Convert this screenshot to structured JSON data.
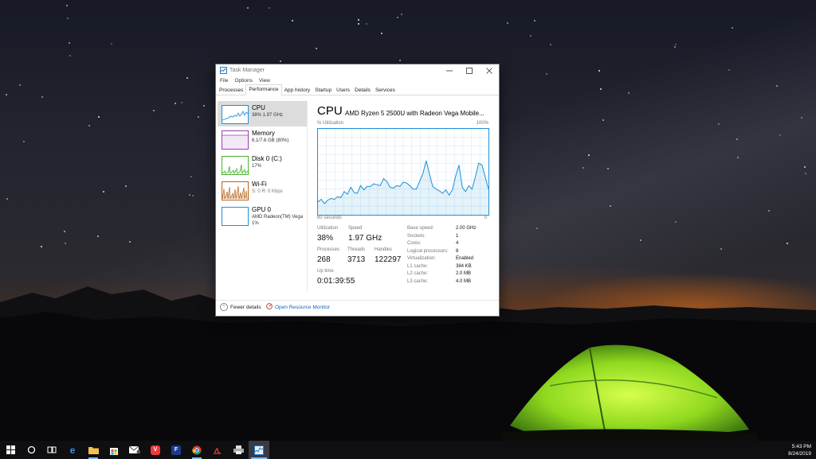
{
  "window": {
    "title": "Task Manager",
    "menu": [
      "File",
      "Options",
      "View"
    ],
    "tabs": [
      "Processes",
      "Performance",
      "App history",
      "Startup",
      "Users",
      "Details",
      "Services"
    ],
    "active_tab": "Performance"
  },
  "resources": [
    {
      "name": "CPU",
      "detail": "38%  1.97 GHz",
      "color": "#1e90d6"
    },
    {
      "name": "Memory",
      "detail": "6.1/7.6 GB (80%)",
      "color": "#9b3fae"
    },
    {
      "name": "Disk 0 (C:)",
      "detail": "17%",
      "color": "#4caf2d"
    },
    {
      "name": "Wi-Fi",
      "detail": "S: 0  R: 0 Kbps",
      "color": "#b8641a"
    },
    {
      "name": "GPU 0",
      "detail": "AMD Radeon(TM) Vega",
      "detail2": "1%",
      "color": "#1e90d6"
    }
  ],
  "cpu": {
    "title": "CPU",
    "model": "AMD Ryzen 5 2500U with Radeon Vega Mobile...",
    "graph_label": "% Utilization",
    "graph_max": "100%",
    "axis_left": "60 seconds",
    "axis_right": "0",
    "utilization_series": [
      15,
      18,
      13,
      17,
      19,
      18,
      21,
      20,
      27,
      24,
      32,
      26,
      25,
      34,
      29,
      33,
      33,
      36,
      35,
      34,
      42,
      39,
      32,
      31,
      34,
      33,
      38,
      37,
      34,
      30,
      30,
      39,
      48,
      63,
      48,
      33,
      30,
      28,
      25,
      29,
      23,
      29,
      45,
      58,
      32,
      27,
      34,
      30,
      44,
      60,
      58,
      44,
      30
    ],
    "stats": {
      "utilization_label": "Utilization",
      "utilization": "38%",
      "speed_label": "Speed",
      "speed": "1.97 GHz",
      "processes_label": "Processes",
      "processes": "268",
      "threads_label": "Threads",
      "threads": "3713",
      "handles_label": "Handles",
      "handles": "122297",
      "uptime_label": "Up time",
      "uptime": "0:01:39:55"
    },
    "specs": [
      {
        "label": "Base speed:",
        "value": "2.00 GHz"
      },
      {
        "label": "Sockets:",
        "value": "1"
      },
      {
        "label": "Cores:",
        "value": "4"
      },
      {
        "label": "Logical processors:",
        "value": "8"
      },
      {
        "label": "Virtualization:",
        "value": "Enabled"
      },
      {
        "label": "L1 cache:",
        "value": "384 KB"
      },
      {
        "label": "L2 cache:",
        "value": "2.0 MB"
      },
      {
        "label": "L3 cache:",
        "value": "4.0 MB"
      }
    ]
  },
  "footer": {
    "fewer_details": "Fewer details",
    "open_resource_monitor": "Open Resource Monitor"
  },
  "taskbar": {
    "icons": [
      "windows-start",
      "search",
      "task-view",
      "edge",
      "file-explorer",
      "store",
      "mail",
      "vivaldi",
      "flipboard",
      "chrome",
      "acrobat",
      "printer",
      "task-manager"
    ],
    "time": "5:43 PM",
    "date": "8/24/2019"
  }
}
